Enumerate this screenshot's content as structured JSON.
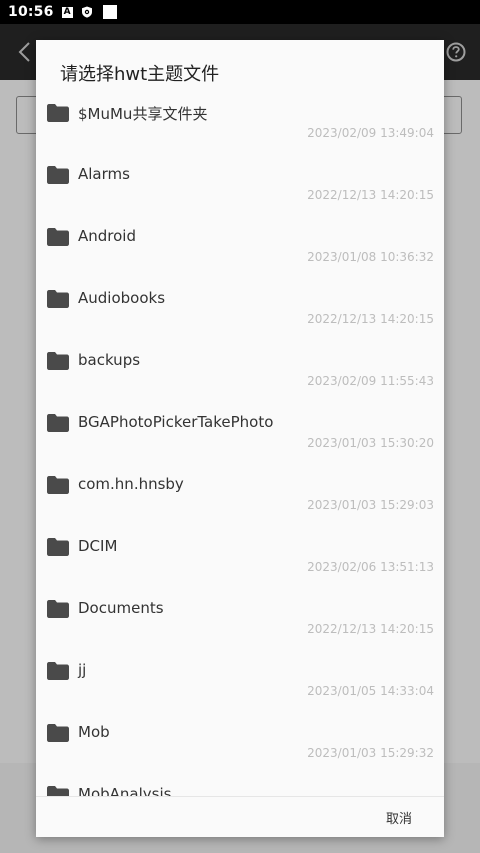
{
  "status_bar": {
    "time": "10:56",
    "icons": [
      "a-notification-icon",
      "shield-icon",
      "square-notification-icon"
    ]
  },
  "app": {
    "back_icon": "chevron-left-icon",
    "help_icon": "help-circle-icon"
  },
  "dialog": {
    "title": "请选择hwt主题文件",
    "files": [
      {
        "name": "$MuMu共享文件夹",
        "date": "2023/02/09 13:49:04"
      },
      {
        "name": "Alarms",
        "date": "2022/12/13 14:20:15"
      },
      {
        "name": "Android",
        "date": "2023/01/08 10:36:32"
      },
      {
        "name": "Audiobooks",
        "date": "2022/12/13 14:20:15"
      },
      {
        "name": "backups",
        "date": "2023/02/09 11:55:43"
      },
      {
        "name": "BGAPhotoPickerTakePhoto",
        "date": "2023/01/03 15:30:20"
      },
      {
        "name": "com.hn.hnsby",
        "date": "2023/01/03 15:29:03"
      },
      {
        "name": "DCIM",
        "date": "2023/02/06 13:51:13"
      },
      {
        "name": "Documents",
        "date": "2022/12/13 14:20:15"
      },
      {
        "name": "jj",
        "date": "2023/01/05 14:33:04"
      },
      {
        "name": "Mob",
        "date": "2023/01/03 15:29:32"
      },
      {
        "name": "MobAnalysis",
        "date": ""
      }
    ],
    "cancel_label": "取消"
  },
  "colors": {
    "status_bar": "#000000",
    "toolbar": "#1f1f1f",
    "scrim": "#bdbdbd",
    "dialog_bg": "#fafafa",
    "folder_icon": "#4a4a4a",
    "date_text": "#bdbdbd"
  }
}
